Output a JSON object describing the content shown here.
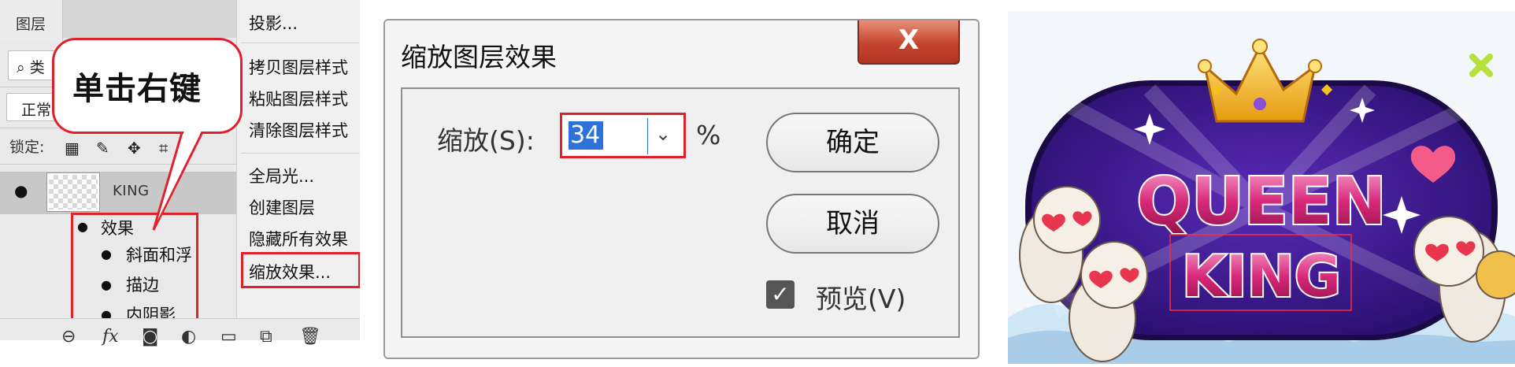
{
  "layers_panel": {
    "tab": "图层",
    "filter_prefix": "类",
    "blend_mode": "正常",
    "lock_label": "锁定:",
    "layer_name": "KING",
    "effects_label": "效果",
    "effects": [
      "斜面和浮",
      "描边",
      "内阴影"
    ],
    "callout": "单击右键",
    "context_menu": [
      "投影...",
      "拷贝图层样式",
      "粘贴图层样式",
      "清除图层样式",
      "全局光...",
      "创建图层",
      "隐藏所有效果",
      "缩放效果..."
    ],
    "footer_icons": [
      "link-icon",
      "fx-icon",
      "mask-icon",
      "adjustment-icon",
      "folder-icon",
      "new-layer-icon",
      "trash-icon"
    ],
    "accent": "#e0202a"
  },
  "dialog": {
    "title": "缩放图层效果",
    "close": "X",
    "scale_label": "缩放(S):",
    "scale_value": "34",
    "unit": "%",
    "ok": "确定",
    "cancel": "取消",
    "preview": "预览(V)",
    "preview_checked": true
  },
  "game_image": {
    "title_top": "QUEEN",
    "title_bottom": "KING",
    "colors": {
      "purple": "#3a1a8c",
      "magenta": "#d4287a",
      "gold": "#f4c21a",
      "sky": "#cfe6f7"
    }
  }
}
